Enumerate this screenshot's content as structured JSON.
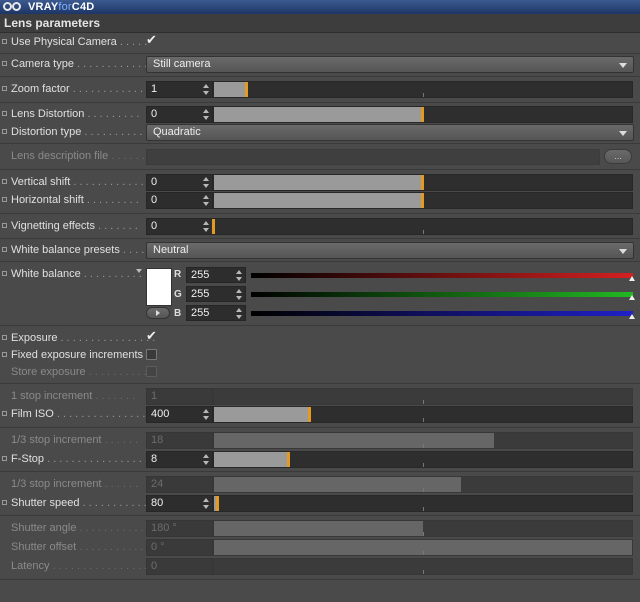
{
  "header": {
    "brand_main": "VRAY",
    "brand_for": "for",
    "brand_c4d": "C4D"
  },
  "section_title": "Lens parameters",
  "dots": ". . . . . . . . . . . . . . . . . . . . . . . . . . . . . . . . . . . . . . . . . . .",
  "use_physical_camera": {
    "label": "Use Physical Camera",
    "checked": true
  },
  "camera_type": {
    "label": "Camera type",
    "value": "Still camera"
  },
  "zoom_factor": {
    "label": "Zoom factor",
    "value": "1",
    "slider_pct": 8
  },
  "lens_distortion": {
    "label": "Lens Distortion",
    "value": "0",
    "slider_pct": 50
  },
  "distortion_type": {
    "label": "Distortion type",
    "value": "Quadratic"
  },
  "lens_description_file": {
    "label": "Lens description file",
    "button": "..."
  },
  "vertical_shift": {
    "label": "Vertical shift",
    "value": "0",
    "slider_pct": 50
  },
  "horizontal_shift": {
    "label": "Horizontal shift",
    "value": "0",
    "slider_pct": 50
  },
  "vignetting_effects": {
    "label": "Vignetting effects",
    "value": "0",
    "slider_pct": 0
  },
  "white_balance_presets": {
    "label": "White balance presets",
    "value": "Neutral"
  },
  "white_balance": {
    "label": "White balance",
    "swatch_color": "#ffffff",
    "channels": [
      {
        "name": "R",
        "value": "255",
        "color": "#d42020"
      },
      {
        "name": "G",
        "value": "255",
        "color": "#22b822"
      },
      {
        "name": "B",
        "value": "255",
        "color": "#2020c8"
      }
    ]
  },
  "exposure": {
    "label": "Exposure",
    "checked": true
  },
  "fixed_exposure_increments": {
    "label": "Fixed exposure increments",
    "checked": false
  },
  "store_exposure": {
    "label": "Store exposure",
    "checked": false
  },
  "one_stop_increment": {
    "label": "1 stop increment",
    "value": "1",
    "slider_pct": 0
  },
  "film_iso": {
    "label": "Film ISO",
    "value": "400",
    "slider_pct": 23
  },
  "third_stop_increment_a": {
    "label": "1/3 stop increment",
    "value": "18",
    "slider_pct": 67
  },
  "f_stop": {
    "label": "F-Stop",
    "value": "8",
    "slider_pct": 18
  },
  "third_stop_increment_b": {
    "label": "1/3 stop increment",
    "value": "24",
    "slider_pct": 59
  },
  "shutter_speed": {
    "label": "Shutter speed",
    "value": "80",
    "slider_pct": 1
  },
  "shutter_angle": {
    "label": "Shutter angle",
    "value": "180 °",
    "slider_pct": 50
  },
  "shutter_offset": {
    "label": "Shutter offset",
    "value": "0 °",
    "slider_pct": 100
  },
  "latency": {
    "label": "Latency",
    "value": "0",
    "slider_pct": 0
  },
  "colors": {
    "knob": "#e39a22",
    "header": "#2a4478",
    "panel": "#4a4a4a"
  }
}
